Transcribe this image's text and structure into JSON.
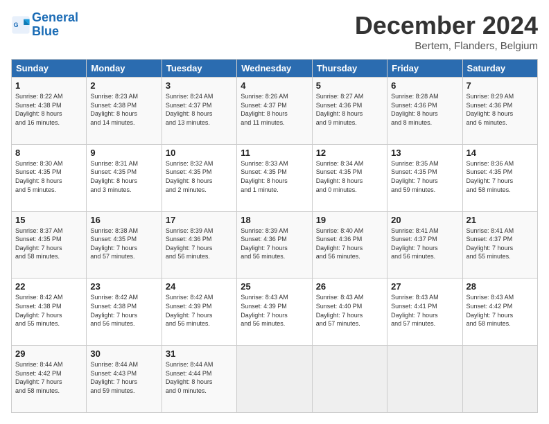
{
  "header": {
    "logo_line1": "General",
    "logo_line2": "Blue",
    "month": "December 2024",
    "location": "Bertem, Flanders, Belgium"
  },
  "weekdays": [
    "Sunday",
    "Monday",
    "Tuesday",
    "Wednesday",
    "Thursday",
    "Friday",
    "Saturday"
  ],
  "weeks": [
    [
      {
        "day": "1",
        "info": "Sunrise: 8:22 AM\nSunset: 4:38 PM\nDaylight: 8 hours\nand 16 minutes."
      },
      {
        "day": "2",
        "info": "Sunrise: 8:23 AM\nSunset: 4:38 PM\nDaylight: 8 hours\nand 14 minutes."
      },
      {
        "day": "3",
        "info": "Sunrise: 8:24 AM\nSunset: 4:37 PM\nDaylight: 8 hours\nand 13 minutes."
      },
      {
        "day": "4",
        "info": "Sunrise: 8:26 AM\nSunset: 4:37 PM\nDaylight: 8 hours\nand 11 minutes."
      },
      {
        "day": "5",
        "info": "Sunrise: 8:27 AM\nSunset: 4:36 PM\nDaylight: 8 hours\nand 9 minutes."
      },
      {
        "day": "6",
        "info": "Sunrise: 8:28 AM\nSunset: 4:36 PM\nDaylight: 8 hours\nand 8 minutes."
      },
      {
        "day": "7",
        "info": "Sunrise: 8:29 AM\nSunset: 4:36 PM\nDaylight: 8 hours\nand 6 minutes."
      }
    ],
    [
      {
        "day": "8",
        "info": "Sunrise: 8:30 AM\nSunset: 4:35 PM\nDaylight: 8 hours\nand 5 minutes."
      },
      {
        "day": "9",
        "info": "Sunrise: 8:31 AM\nSunset: 4:35 PM\nDaylight: 8 hours\nand 3 minutes."
      },
      {
        "day": "10",
        "info": "Sunrise: 8:32 AM\nSunset: 4:35 PM\nDaylight: 8 hours\nand 2 minutes."
      },
      {
        "day": "11",
        "info": "Sunrise: 8:33 AM\nSunset: 4:35 PM\nDaylight: 8 hours\nand 1 minute."
      },
      {
        "day": "12",
        "info": "Sunrise: 8:34 AM\nSunset: 4:35 PM\nDaylight: 8 hours\nand 0 minutes."
      },
      {
        "day": "13",
        "info": "Sunrise: 8:35 AM\nSunset: 4:35 PM\nDaylight: 7 hours\nand 59 minutes."
      },
      {
        "day": "14",
        "info": "Sunrise: 8:36 AM\nSunset: 4:35 PM\nDaylight: 7 hours\nand 58 minutes."
      }
    ],
    [
      {
        "day": "15",
        "info": "Sunrise: 8:37 AM\nSunset: 4:35 PM\nDaylight: 7 hours\nand 58 minutes."
      },
      {
        "day": "16",
        "info": "Sunrise: 8:38 AM\nSunset: 4:35 PM\nDaylight: 7 hours\nand 57 minutes."
      },
      {
        "day": "17",
        "info": "Sunrise: 8:39 AM\nSunset: 4:36 PM\nDaylight: 7 hours\nand 56 minutes."
      },
      {
        "day": "18",
        "info": "Sunrise: 8:39 AM\nSunset: 4:36 PM\nDaylight: 7 hours\nand 56 minutes."
      },
      {
        "day": "19",
        "info": "Sunrise: 8:40 AM\nSunset: 4:36 PM\nDaylight: 7 hours\nand 56 minutes."
      },
      {
        "day": "20",
        "info": "Sunrise: 8:41 AM\nSunset: 4:37 PM\nDaylight: 7 hours\nand 56 minutes."
      },
      {
        "day": "21",
        "info": "Sunrise: 8:41 AM\nSunset: 4:37 PM\nDaylight: 7 hours\nand 55 minutes."
      }
    ],
    [
      {
        "day": "22",
        "info": "Sunrise: 8:42 AM\nSunset: 4:38 PM\nDaylight: 7 hours\nand 55 minutes."
      },
      {
        "day": "23",
        "info": "Sunrise: 8:42 AM\nSunset: 4:38 PM\nDaylight: 7 hours\nand 56 minutes."
      },
      {
        "day": "24",
        "info": "Sunrise: 8:42 AM\nSunset: 4:39 PM\nDaylight: 7 hours\nand 56 minutes."
      },
      {
        "day": "25",
        "info": "Sunrise: 8:43 AM\nSunset: 4:39 PM\nDaylight: 7 hours\nand 56 minutes."
      },
      {
        "day": "26",
        "info": "Sunrise: 8:43 AM\nSunset: 4:40 PM\nDaylight: 7 hours\nand 57 minutes."
      },
      {
        "day": "27",
        "info": "Sunrise: 8:43 AM\nSunset: 4:41 PM\nDaylight: 7 hours\nand 57 minutes."
      },
      {
        "day": "28",
        "info": "Sunrise: 8:43 AM\nSunset: 4:42 PM\nDaylight: 7 hours\nand 58 minutes."
      }
    ],
    [
      {
        "day": "29",
        "info": "Sunrise: 8:44 AM\nSunset: 4:42 PM\nDaylight: 7 hours\nand 58 minutes."
      },
      {
        "day": "30",
        "info": "Sunrise: 8:44 AM\nSunset: 4:43 PM\nDaylight: 7 hours\nand 59 minutes."
      },
      {
        "day": "31",
        "info": "Sunrise: 8:44 AM\nSunset: 4:44 PM\nDaylight: 8 hours\nand 0 minutes."
      },
      null,
      null,
      null,
      null
    ]
  ]
}
